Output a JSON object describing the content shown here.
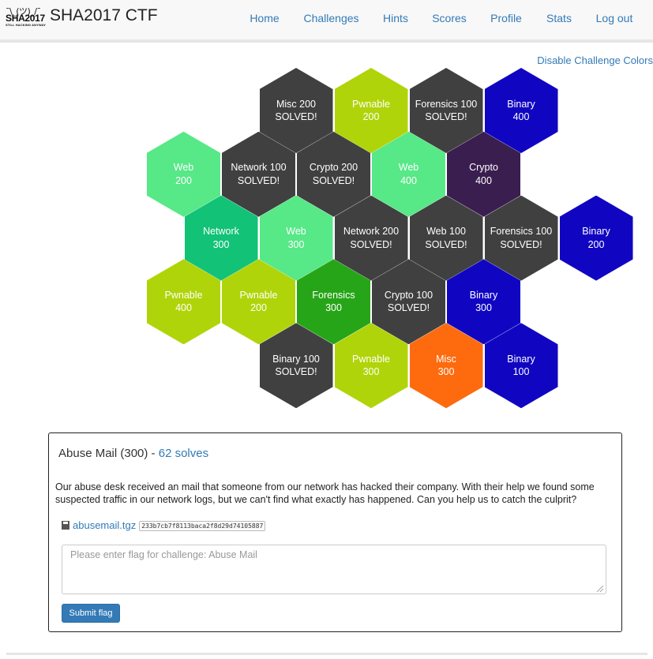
{
  "brand": {
    "logo_face": "¯\\_(ツ)_/¯",
    "logo_mark": "SHA2017",
    "logo_tagline": "STILL HACKING ANYWAY",
    "title": "SHA2017 CTF"
  },
  "nav": [
    {
      "label": "Home",
      "active": false
    },
    {
      "label": "Challenges",
      "active": true
    },
    {
      "label": "Hints",
      "active": false
    },
    {
      "label": "Scores",
      "active": false
    },
    {
      "label": "Profile",
      "active": false
    },
    {
      "label": "Stats",
      "active": false
    },
    {
      "label": "Log out",
      "active": false
    }
  ],
  "toggle_colors_label": "Disable Challenge Colors",
  "hexes": [
    {
      "row": 0,
      "col": 1,
      "name": "Misc 200",
      "value": "SOLVED!",
      "color": "#404040"
    },
    {
      "row": 0,
      "col": 2,
      "name": "Pwnable",
      "value": "200",
      "color": "#b0d40a"
    },
    {
      "row": 0,
      "col": 3,
      "name": "Forensics 100",
      "value": "SOLVED!",
      "color": "#404040"
    },
    {
      "row": 0,
      "col": 4,
      "name": "Binary",
      "value": "400",
      "color": "#1006c2"
    },
    {
      "row": 1,
      "col": 0,
      "name": "Web",
      "value": "200",
      "color": "#57e887"
    },
    {
      "row": 1,
      "col": 1,
      "name": "Network 100",
      "value": "SOLVED!",
      "color": "#404040"
    },
    {
      "row": 1,
      "col": 2,
      "name": "Crypto 200",
      "value": "SOLVED!",
      "color": "#404040"
    },
    {
      "row": 1,
      "col": 3,
      "name": "Web",
      "value": "400",
      "color": "#57e887"
    },
    {
      "row": 1,
      "col": 4,
      "name": "Crypto",
      "value": "400",
      "color": "#3a1e50"
    },
    {
      "row": 2,
      "col": 0,
      "name": "Network",
      "value": "300",
      "color": "#12c277"
    },
    {
      "row": 2,
      "col": 1,
      "name": "Web",
      "value": "300",
      "color": "#57e887"
    },
    {
      "row": 2,
      "col": 2,
      "name": "Network 200",
      "value": "SOLVED!",
      "color": "#404040"
    },
    {
      "row": 2,
      "col": 3,
      "name": "Web 100",
      "value": "SOLVED!",
      "color": "#404040"
    },
    {
      "row": 2,
      "col": 4,
      "name": "Forensics 100",
      "value": "SOLVED!",
      "color": "#404040"
    },
    {
      "row": 2,
      "col": 5,
      "name": "Binary",
      "value": "200",
      "color": "#1006c2"
    },
    {
      "row": 3,
      "col": 0,
      "name": "Pwnable",
      "value": "400",
      "color": "#b0d40a"
    },
    {
      "row": 3,
      "col": 1,
      "name": "Pwnable",
      "value": "200",
      "color": "#b0d40a"
    },
    {
      "row": 3,
      "col": 2,
      "name": "Forensics",
      "value": "300",
      "color": "#27a518"
    },
    {
      "row": 3,
      "col": 3,
      "name": "Crypto 100",
      "value": "SOLVED!",
      "color": "#404040"
    },
    {
      "row": 3,
      "col": 4,
      "name": "Binary",
      "value": "300",
      "color": "#1006c2"
    },
    {
      "row": 4,
      "col": 1,
      "name": "Binary 100",
      "value": "SOLVED!",
      "color": "#404040"
    },
    {
      "row": 4,
      "col": 2,
      "name": "Pwnable",
      "value": "300",
      "color": "#b0d40a"
    },
    {
      "row": 4,
      "col": 3,
      "name": "Misc",
      "value": "300",
      "color": "#fe6a0e"
    },
    {
      "row": 4,
      "col": 4,
      "name": "Binary",
      "value": "100",
      "color": "#1006c2"
    }
  ],
  "challenge": {
    "title": "Abuse Mail (300)",
    "separator": " - ",
    "solves": "62 solves",
    "description": "Our abuse desk received an mail that someone from our network has hacked their company. With their help we found some suspected traffic in our network logs, but we can't find what exactly has happened. Can you help us to catch the culprit?",
    "file_name": "abusemail.tgz",
    "file_hash": "233b7cb7f8113baca2f8d29d74105887",
    "flag_placeholder": "Please enter flag for challenge: Abuse Mail",
    "flag_value": "",
    "submit_label": "Submit flag"
  }
}
